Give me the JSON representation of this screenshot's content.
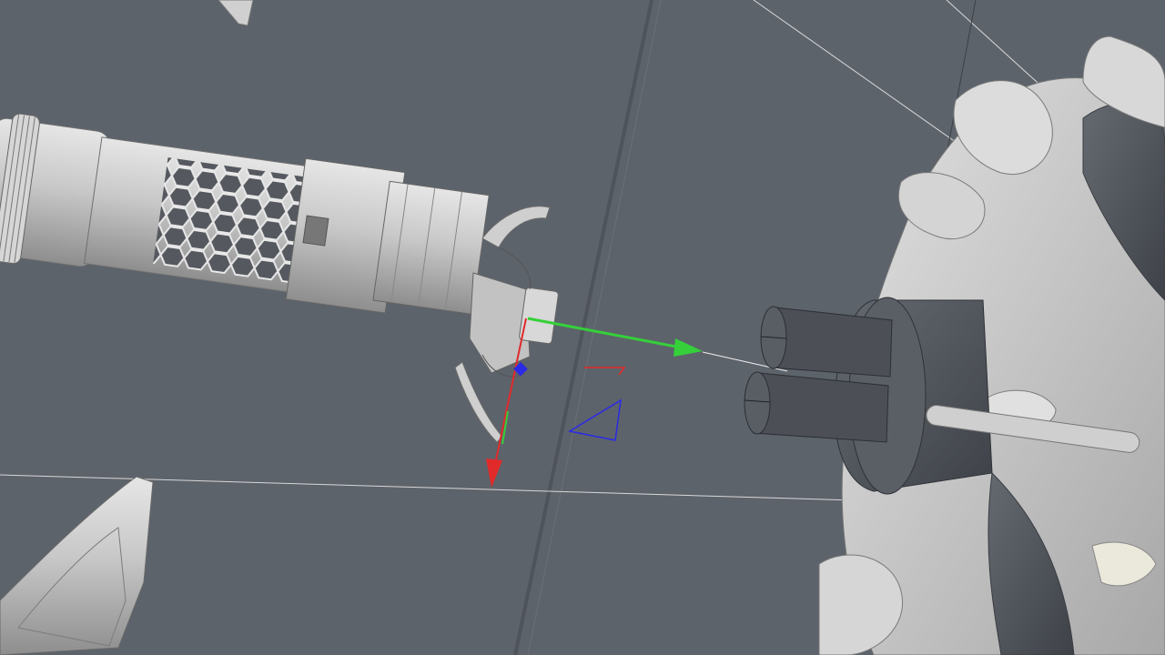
{
  "viewport": {
    "view": "perspective",
    "background_color": "#5d636b",
    "model_color": "#c9c9c9",
    "dark_model_color": "#4d5157",
    "gizmo": {
      "x_axis_color": "#e12a2a",
      "y_axis_color": "#35d03a",
      "z_axis_color": "#2a2ae6",
      "axes": [
        "x",
        "y",
        "z"
      ]
    },
    "objects": [
      "silencer-cylinder",
      "claw-gripper",
      "round-connector",
      "organic-frame",
      "blade-fragment"
    ]
  }
}
